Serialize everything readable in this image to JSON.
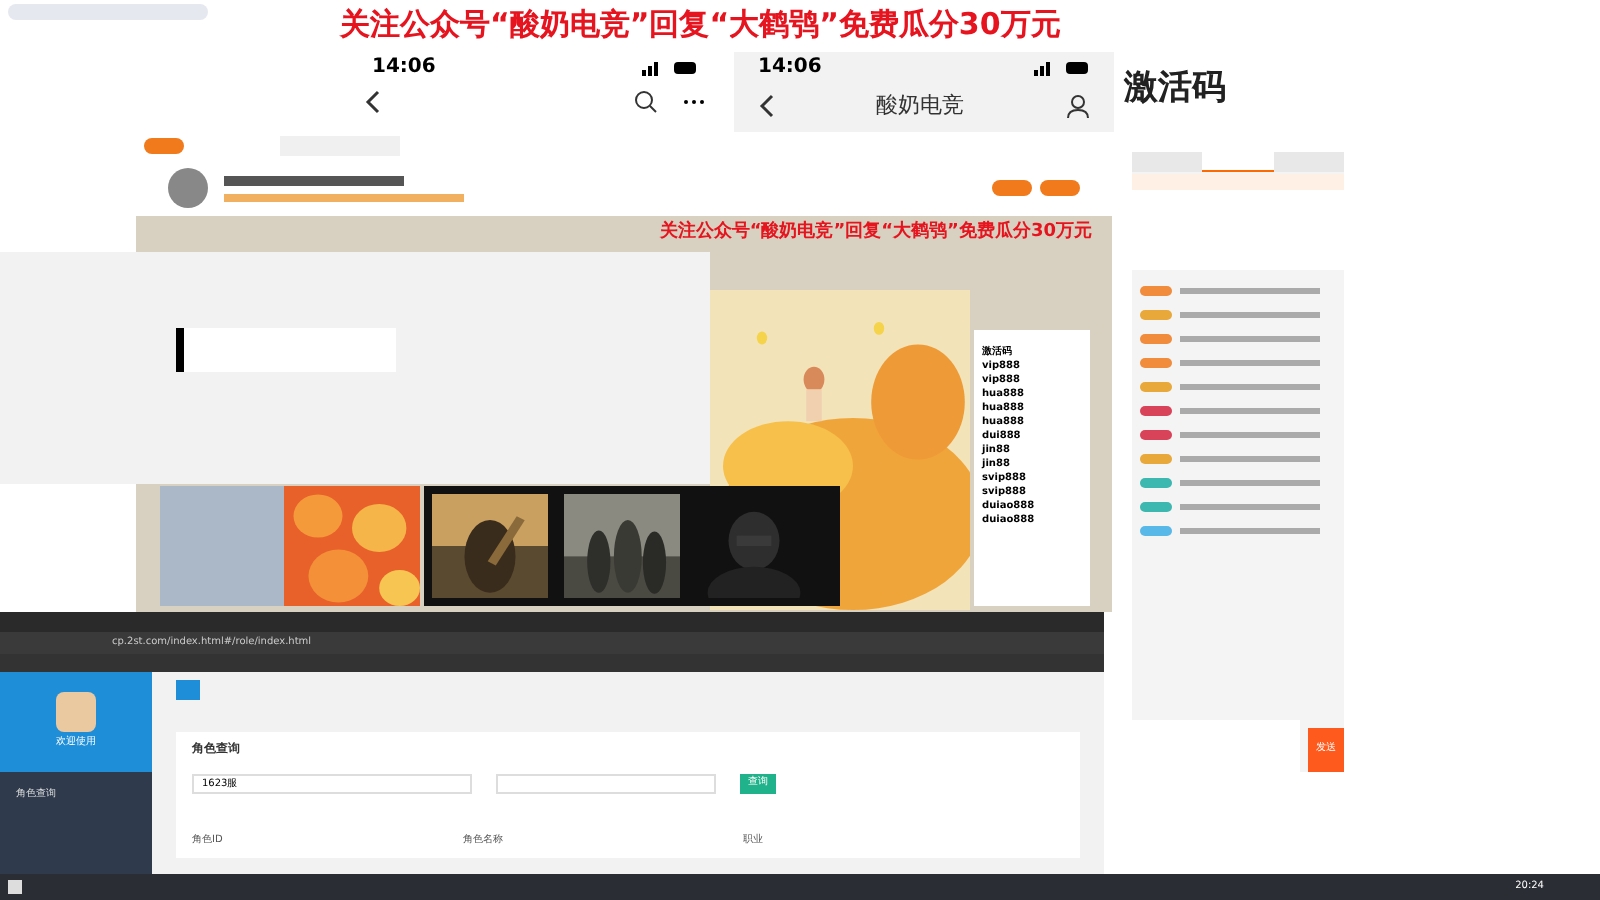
{
  "banner": {
    "text": "关注公众号“酸奶电竞”回复“大鹤鸮”免费瓜分30万元"
  },
  "phone_left": {
    "time": "14:06"
  },
  "phone_right": {
    "time": "14:06",
    "title": "酸奶电竞"
  },
  "note": {
    "text": "激活码"
  },
  "stream": {
    "overlay_text": "关注公众号“酸奶电竞”回复“大鹤鸮”免费瓜分30万元",
    "code_list": {
      "title": "激活码",
      "items": [
        "vip888",
        "vip888",
        "hua888",
        "hua888",
        "hua888",
        "dui888",
        "jin88",
        "jin88",
        "svip888",
        "svip888",
        "duiao888",
        "duiao888"
      ]
    }
  },
  "chat": {
    "tabs": [
      {
        "selected": false
      },
      {
        "selected": true
      },
      {
        "selected": false
      }
    ],
    "messages": [
      {
        "color": "#f08c3c"
      },
      {
        "color": "#e8a93a"
      },
      {
        "color": "#f08c3c"
      },
      {
        "color": "#f08c3c"
      },
      {
        "color": "#e8a93a"
      },
      {
        "color": "#d9435a"
      },
      {
        "color": "#d9435a"
      },
      {
        "color": "#e8a93a"
      },
      {
        "color": "#3cb8b0"
      },
      {
        "color": "#3cb8b0"
      },
      {
        "color": "#58b8e8"
      }
    ],
    "send": "发送"
  },
  "browser": {
    "url": "cp.2st.com/index.html#/role/index.html",
    "sidebar": {
      "welcome": "欢迎使用",
      "items": [
        {
          "label": "角色查询",
          "selected": false
        }
      ]
    },
    "query": {
      "title": "角色查询",
      "select_value": "1623服",
      "button": "查询",
      "columns": [
        "角色ID",
        "角色名称",
        "职业"
      ]
    }
  },
  "taskbar": {
    "time": "20:24"
  }
}
